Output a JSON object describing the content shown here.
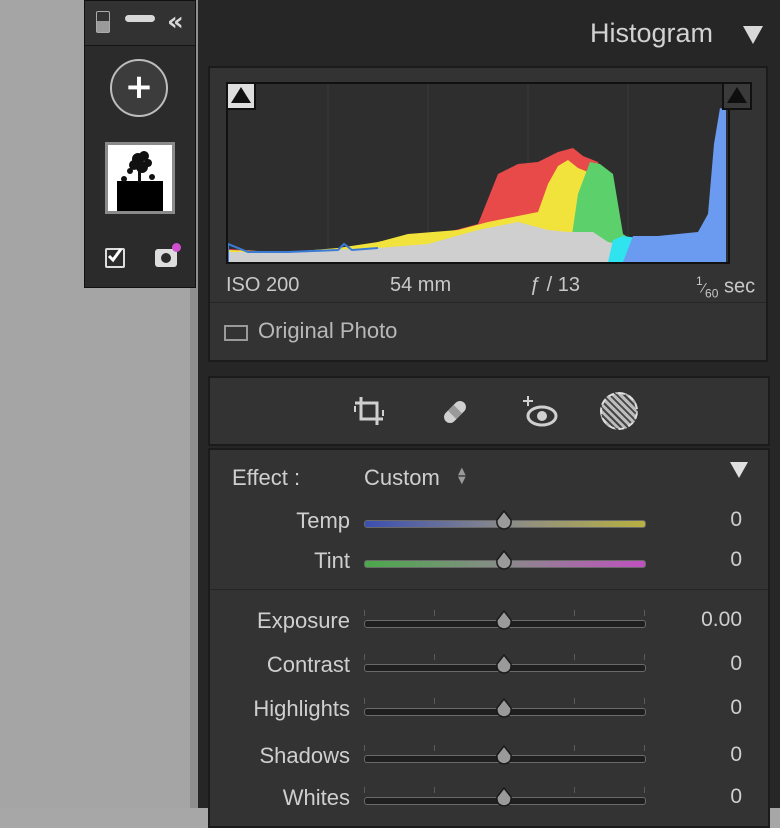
{
  "histogram": {
    "title": "Histogram",
    "iso": "ISO 200",
    "focal": "54 mm",
    "aperture": "ƒ / 13",
    "shutter_num": "1",
    "shutter_den": "60",
    "shutter_unit": "sec",
    "original_photo": "Original Photo"
  },
  "basic": {
    "effect_label": "Effect :",
    "effect_value": "Custom",
    "sliders": [
      {
        "label": "Temp",
        "value": "0"
      },
      {
        "label": "Tint",
        "value": "0"
      },
      {
        "label": "Exposure",
        "value": "0.00"
      },
      {
        "label": "Contrast",
        "value": "0"
      },
      {
        "label": "Highlights",
        "value": "0"
      },
      {
        "label": "Shadows",
        "value": "0"
      },
      {
        "label": "Whites",
        "value": "0"
      }
    ]
  },
  "icons": [
    "collapse-left-icon",
    "add-preset-icon",
    "checkbox-icon",
    "snapshot-icon",
    "crop-icon",
    "healing-icon",
    "redeye-icon",
    "mask-icon",
    "triangle-down-icon"
  ],
  "colors": {
    "panel": "#333333",
    "background": "#262626",
    "accent_magenta": "#d050d0"
  }
}
